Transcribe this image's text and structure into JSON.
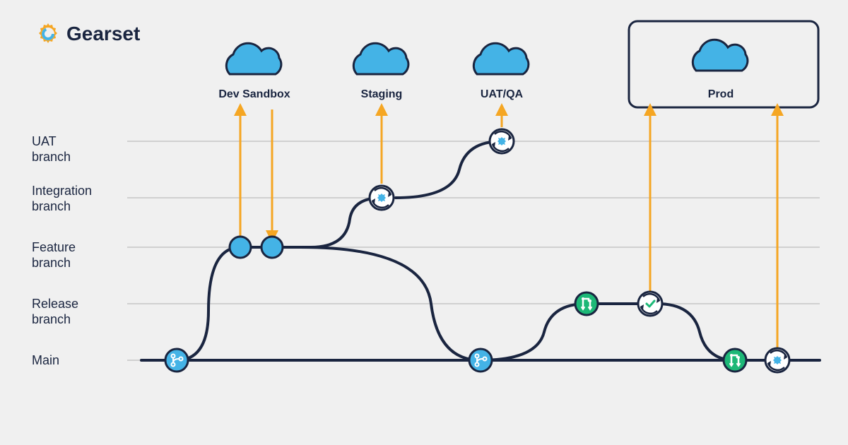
{
  "brand": {
    "name": "Gearset"
  },
  "environments": {
    "dev": "Dev Sandbox",
    "staging": "Staging",
    "uat": "UAT/QA",
    "prod": "Prod"
  },
  "branches": {
    "uat": "UAT\nbranch",
    "integration": "Integration\nbranch",
    "feature": "Feature\nbranch",
    "release": "Release\nbranch",
    "main": "Main"
  },
  "colors": {
    "navy": "#1a2540",
    "blue": "#44b3e6",
    "green": "#1db877",
    "orange": "#f5a623",
    "grid": "#d0d0d0"
  }
}
